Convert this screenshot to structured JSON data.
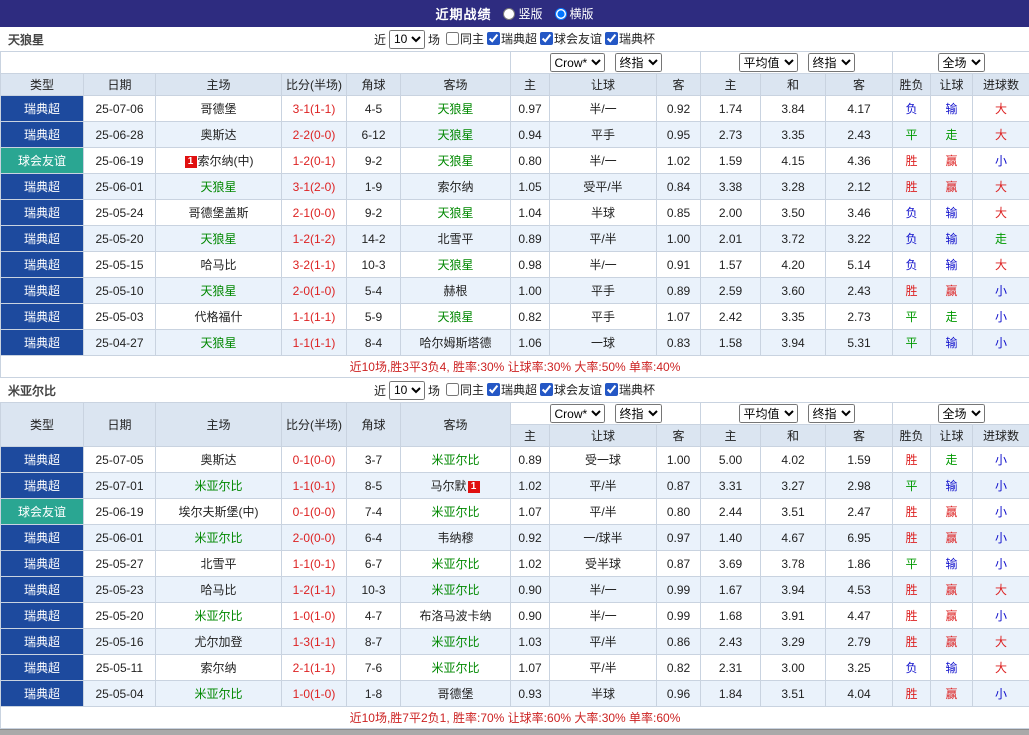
{
  "colors": {
    "titlebar": "#2e2c80",
    "league": "#1d4a9e",
    "friendly": "#2aa692",
    "header-bg": "#dbe5f1",
    "row-alt": "#eaf2fb",
    "border": "#c9d3e0",
    "focus": "#008800",
    "red": "#dd2222",
    "green": "#009900",
    "blue": "#1111cc",
    "summary": "#cc2222"
  },
  "titlebar": {
    "title": "近期战绩",
    "vertical_label": "竖版",
    "horizontal_label": "横版",
    "selected": "横版"
  },
  "filter": {
    "near_label": "近",
    "count": "10",
    "matches_label": "场",
    "checkboxes": [
      {
        "label": "同主",
        "checked": false
      },
      {
        "label": "瑞典超",
        "checked": true
      },
      {
        "label": "球会友谊",
        "checked": true
      },
      {
        "label": "瑞典杯",
        "checked": true
      }
    ]
  },
  "dropdowns": {
    "bookmaker": "Crow*",
    "final1": "终指",
    "average": "平均值",
    "final2": "终指",
    "scope": "全场"
  },
  "columns": [
    "类型",
    "日期",
    "主场",
    "比分(半场)",
    "角球",
    "客场",
    "主",
    "让球",
    "客",
    "主",
    "和",
    "客",
    "胜负",
    "让球",
    "进球数"
  ],
  "result_colors": {
    "胜": "red",
    "平": "green",
    "负": "blue",
    "赢": "red",
    "走": "green",
    "输": "blue",
    "大": "red",
    "小": "blue"
  },
  "sections": [
    {
      "team": "天狼星",
      "summary": "近10场,胜3平3负4, 胜率:30% 让球率:30% 大率:50% 单率:40%",
      "rows": [
        {
          "type": "瑞典超",
          "date": "25-07-06",
          "home": "哥德堡",
          "score": "3-1(1-1)",
          "corner": "4-5",
          "away": "天狼星",
          "awayGreen": true,
          "ahH": "0.97",
          "ahLine": "半/一",
          "ahA": "0.92",
          "euH": "1.74",
          "euD": "3.84",
          "euA": "4.17",
          "res": "负",
          "ahRes": "输",
          "ouRes": "大"
        },
        {
          "type": "瑞典超",
          "date": "25-06-28",
          "home": "奥斯达",
          "score": "2-2(0-0)",
          "corner": "6-12",
          "away": "天狼星",
          "awayGreen": true,
          "ahH": "0.94",
          "ahLine": "平手",
          "ahA": "0.95",
          "euH": "2.73",
          "euD": "3.35",
          "euA": "2.43",
          "res": "平",
          "ahRes": "走",
          "ouRes": "大"
        },
        {
          "type": "球会友谊",
          "friendly": true,
          "date": "25-06-19",
          "home": "索尔纳(中)",
          "homeBadge": "1",
          "homeBadgePos": "before",
          "score": "1-2(0-1)",
          "corner": "9-2",
          "away": "天狼星",
          "awayGreen": true,
          "ahH": "0.80",
          "ahLine": "半/一",
          "ahA": "1.02",
          "euH": "1.59",
          "euD": "4.15",
          "euA": "4.36",
          "res": "胜",
          "ahRes": "赢",
          "ouRes": "小"
        },
        {
          "type": "瑞典超",
          "date": "25-06-01",
          "home": "天狼星",
          "homeGreen": true,
          "score": "3-1(2-0)",
          "corner": "1-9",
          "away": "索尔纳",
          "ahH": "1.05",
          "ahLine": "受平/半",
          "ahA": "0.84",
          "euH": "3.38",
          "euD": "3.28",
          "euA": "2.12",
          "res": "胜",
          "ahRes": "赢",
          "ouRes": "大"
        },
        {
          "type": "瑞典超",
          "date": "25-05-24",
          "home": "哥德堡盖斯",
          "score": "2-1(0-0)",
          "corner": "9-2",
          "away": "天狼星",
          "awayGreen": true,
          "ahH": "1.04",
          "ahLine": "半球",
          "ahA": "0.85",
          "euH": "2.00",
          "euD": "3.50",
          "euA": "3.46",
          "res": "负",
          "ahRes": "输",
          "ouRes": "大"
        },
        {
          "type": "瑞典超",
          "date": "25-05-20",
          "home": "天狼星",
          "homeGreen": true,
          "score": "1-2(1-2)",
          "corner": "14-2",
          "away": "北雪平",
          "ahH": "0.89",
          "ahLine": "平/半",
          "ahA": "1.00",
          "euH": "2.01",
          "euD": "3.72",
          "euA": "3.22",
          "res": "负",
          "ahRes": "输",
          "ouRes": "走"
        },
        {
          "type": "瑞典超",
          "date": "25-05-15",
          "home": "哈马比",
          "score": "3-2(1-1)",
          "corner": "10-3",
          "away": "天狼星",
          "awayGreen": true,
          "ahH": "0.98",
          "ahLine": "半/一",
          "ahA": "0.91",
          "euH": "1.57",
          "euD": "4.20",
          "euA": "5.14",
          "res": "负",
          "ahRes": "输",
          "ouRes": "大"
        },
        {
          "type": "瑞典超",
          "date": "25-05-10",
          "home": "天狼星",
          "homeGreen": true,
          "score": "2-0(1-0)",
          "corner": "5-4",
          "away": "赫根",
          "ahH": "1.00",
          "ahLine": "平手",
          "ahA": "0.89",
          "euH": "2.59",
          "euD": "3.60",
          "euA": "2.43",
          "res": "胜",
          "ahRes": "赢",
          "ouRes": "小"
        },
        {
          "type": "瑞典超",
          "date": "25-05-03",
          "home": "代格福什",
          "score": "1-1(1-1)",
          "corner": "5-9",
          "away": "天狼星",
          "awayGreen": true,
          "ahH": "0.82",
          "ahLine": "平手",
          "ahA": "1.07",
          "euH": "2.42",
          "euD": "3.35",
          "euA": "2.73",
          "res": "平",
          "ahRes": "走",
          "ouRes": "小"
        },
        {
          "type": "瑞典超",
          "date": "25-04-27",
          "home": "天狼星",
          "homeGreen": true,
          "score": "1-1(1-1)",
          "corner": "8-4",
          "away": "哈尔姆斯塔德",
          "ahH": "1.06",
          "ahLine": "一球",
          "ahA": "0.83",
          "euH": "1.58",
          "euD": "3.94",
          "euA": "5.31",
          "res": "平",
          "ahRes": "输",
          "ouRes": "小"
        }
      ]
    },
    {
      "team": "米亚尔比",
      "summary": "近10场,胜7平2负1, 胜率:70% 让球率:60% 大率:30% 单率:60%",
      "rows": [
        {
          "type": "瑞典超",
          "date": "25-07-05",
          "home": "奥斯达",
          "score": "0-1(0-0)",
          "corner": "3-7",
          "away": "米亚尔比",
          "awayGreen": true,
          "ahH": "0.89",
          "ahLine": "受一球",
          "ahA": "1.00",
          "euH": "5.00",
          "euD": "4.02",
          "euA": "1.59",
          "res": "胜",
          "ahRes": "走",
          "ouRes": "小"
        },
        {
          "type": "瑞典超",
          "date": "25-07-01",
          "home": "米亚尔比",
          "homeGreen": true,
          "score": "1-1(0-1)",
          "corner": "8-5",
          "away": "马尔默",
          "awayBadge": "1",
          "awayBadgePos": "after",
          "ahH": "1.02",
          "ahLine": "平/半",
          "ahA": "0.87",
          "euH": "3.31",
          "euD": "3.27",
          "euA": "2.98",
          "res": "平",
          "ahRes": "输",
          "ouRes": "小"
        },
        {
          "type": "球会友谊",
          "friendly": true,
          "date": "25-06-19",
          "home": "埃尔夫斯堡(中)",
          "score": "0-1(0-0)",
          "corner": "7-4",
          "away": "米亚尔比",
          "awayGreen": true,
          "ahH": "1.07",
          "ahLine": "平/半",
          "ahA": "0.80",
          "euH": "2.44",
          "euD": "3.51",
          "euA": "2.47",
          "res": "胜",
          "ahRes": "赢",
          "ouRes": "小"
        },
        {
          "type": "瑞典超",
          "date": "25-06-01",
          "home": "米亚尔比",
          "homeGreen": true,
          "score": "2-0(0-0)",
          "corner": "6-4",
          "away": "韦纳穆",
          "ahH": "0.92",
          "ahLine": "一/球半",
          "ahA": "0.97",
          "euH": "1.40",
          "euD": "4.67",
          "euA": "6.95",
          "res": "胜",
          "ahRes": "赢",
          "ouRes": "小"
        },
        {
          "type": "瑞典超",
          "date": "25-05-27",
          "home": "北雪平",
          "score": "1-1(0-1)",
          "corner": "6-7",
          "away": "米亚尔比",
          "awayGreen": true,
          "ahH": "1.02",
          "ahLine": "受半球",
          "ahA": "0.87",
          "euH": "3.69",
          "euD": "3.78",
          "euA": "1.86",
          "res": "平",
          "ahRes": "输",
          "ouRes": "小"
        },
        {
          "type": "瑞典超",
          "date": "25-05-23",
          "home": "哈马比",
          "score": "1-2(1-1)",
          "corner": "10-3",
          "away": "米亚尔比",
          "awayGreen": true,
          "ahH": "0.90",
          "ahLine": "半/一",
          "ahA": "0.99",
          "euH": "1.67",
          "euD": "3.94",
          "euA": "4.53",
          "res": "胜",
          "ahRes": "赢",
          "ouRes": "大"
        },
        {
          "type": "瑞典超",
          "date": "25-05-20",
          "home": "米亚尔比",
          "homeGreen": true,
          "score": "1-0(1-0)",
          "corner": "4-7",
          "away": "布洛马波卡纳",
          "ahH": "0.90",
          "ahLine": "半/一",
          "ahA": "0.99",
          "euH": "1.68",
          "euD": "3.91",
          "euA": "4.47",
          "res": "胜",
          "ahRes": "赢",
          "ouRes": "小"
        },
        {
          "type": "瑞典超",
          "date": "25-05-16",
          "home": "尤尔加登",
          "score": "1-3(1-1)",
          "corner": "8-7",
          "away": "米亚尔比",
          "awayGreen": true,
          "ahH": "1.03",
          "ahLine": "平/半",
          "ahA": "0.86",
          "euH": "2.43",
          "euD": "3.29",
          "euA": "2.79",
          "res": "胜",
          "ahRes": "赢",
          "ouRes": "大"
        },
        {
          "type": "瑞典超",
          "date": "25-05-11",
          "home": "索尔纳",
          "score": "2-1(1-1)",
          "corner": "7-6",
          "away": "米亚尔比",
          "awayGreen": true,
          "ahH": "1.07",
          "ahLine": "平/半",
          "ahA": "0.82",
          "euH": "2.31",
          "euD": "3.00",
          "euA": "3.25",
          "res": "负",
          "ahRes": "输",
          "ouRes": "大"
        },
        {
          "type": "瑞典超",
          "date": "25-05-04",
          "home": "米亚尔比",
          "homeGreen": true,
          "score": "1-0(1-0)",
          "corner": "1-8",
          "away": "哥德堡",
          "ahH": "0.93",
          "ahLine": "半球",
          "ahA": "0.96",
          "euH": "1.84",
          "euD": "3.51",
          "euA": "4.04",
          "res": "胜",
          "ahRes": "赢",
          "ouRes": "小"
        }
      ]
    }
  ]
}
